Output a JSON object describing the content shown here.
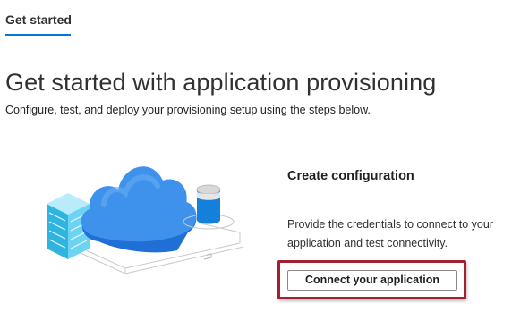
{
  "tabs": [
    {
      "label": "Get started",
      "selected": true
    }
  ],
  "header": {
    "title": "Get started with application provisioning",
    "subtitle": "Configure, test, and deploy your provisioning setup using the steps below."
  },
  "card": {
    "heading": "Create configuration",
    "description": "Provide the credentials to connect to your application and test connectivity.",
    "button_label": "Connect your application",
    "illustration_icons": [
      "server-stack-icon",
      "cloud-icon",
      "database-icon"
    ]
  },
  "colors": {
    "accent": "#0078d4",
    "highlight_border": "#a0212f",
    "text": "#201f1e"
  }
}
